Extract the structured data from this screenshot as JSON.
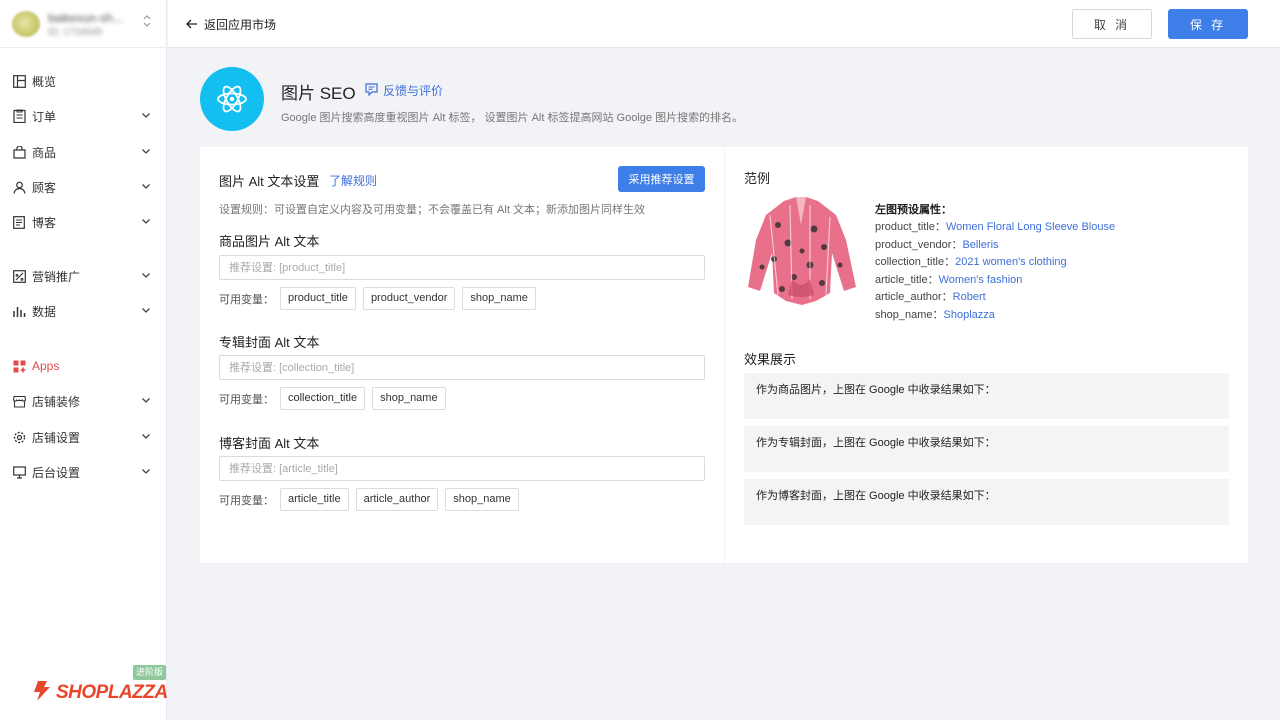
{
  "store": {
    "name": "baikexun-sh...",
    "id": "ID: 1716545"
  },
  "nav": {
    "items": [
      {
        "label": "概览"
      },
      {
        "label": "订单"
      },
      {
        "label": "商品"
      },
      {
        "label": "顾客"
      },
      {
        "label": "博客"
      },
      {
        "label": "营销推广"
      },
      {
        "label": "数据"
      },
      {
        "label": "Apps"
      },
      {
        "label": "店铺装修"
      },
      {
        "label": "店铺设置"
      },
      {
        "label": "后台设置"
      }
    ],
    "plan_badge": "进阶版",
    "logo_text": "SHOPLAZZA"
  },
  "topbar": {
    "back_label": "返回应用市场",
    "cancel_label": "取 消",
    "save_label": "保 存"
  },
  "app": {
    "title": "图片 SEO",
    "feedback_label": "反馈与评价",
    "description": "Google 图片搜索高度重视图片 Alt 标签， 设置图片 Alt 标签提高网站 Goolge 图片搜索的排名。"
  },
  "settings": {
    "title": "图片 Alt 文本设置",
    "rules_link": "了解规则",
    "recommend_button": "采用推荐设置",
    "rule_text": "设置规则：可设置自定义内容及可用变量；不会覆盖已有 Alt 文本；新添加图片同样生效",
    "vars_label": "可用变量：",
    "product": {
      "title": "商品图片 Alt 文本",
      "placeholder": "推荐设置: [product_title]",
      "vars": [
        "product_title",
        "product_vendor",
        "shop_name"
      ]
    },
    "collection": {
      "title": "专辑封面 Alt 文本",
      "placeholder": "推荐设置: [collection_title]",
      "vars": [
        "collection_title",
        "shop_name"
      ]
    },
    "blog": {
      "title": "博客封面 Alt 文本",
      "placeholder": "推荐设置: [article_title]",
      "vars": [
        "article_title",
        "article_author",
        "shop_name"
      ]
    }
  },
  "example": {
    "title": "范例",
    "attr_head": "左图预设属性：",
    "attrs": [
      {
        "key": "product_title：",
        "value": "Women Floral Long Sleeve Blouse"
      },
      {
        "key": "product_vendor：",
        "value": "Belleris"
      },
      {
        "key": "collection_title：",
        "value": "2021 women's clothing"
      },
      {
        "key": "article_title：",
        "value": "Women's fashion"
      },
      {
        "key": "article_author：",
        "value": "Robert"
      },
      {
        "key": "shop_name：",
        "value": "Shoplazza"
      }
    ],
    "effect_title": "效果展示",
    "results": [
      "作为商品图片，上图在 Google 中收录结果如下：",
      "作为专辑封面，上图在 Google 中收录结果如下：",
      "作为博客封面，上图在 Google 中收录结果如下："
    ]
  },
  "colors": {
    "primary": "#3e7ee8",
    "link": "#3e6fd8",
    "app_icon": "#13bff0",
    "brand": "#e8472b",
    "badge": "#8fc89c"
  }
}
